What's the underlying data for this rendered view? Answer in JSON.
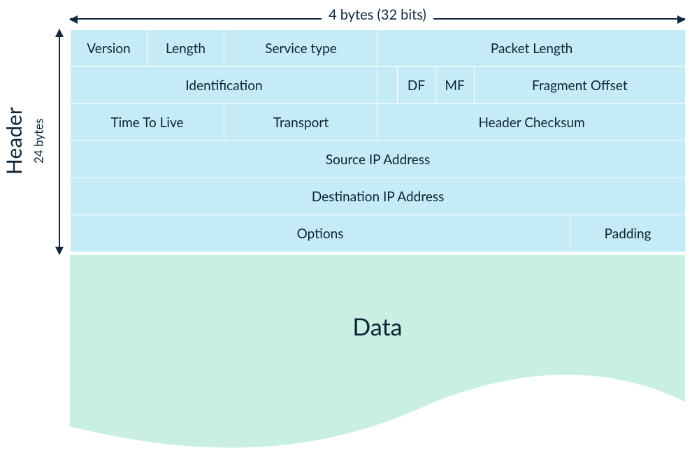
{
  "dimensions": {
    "width_label": "4 bytes (32 bits)",
    "height_label": "24 bytes",
    "section_label": "Header"
  },
  "header_rows": [
    [
      {
        "span": 4,
        "label": "Version"
      },
      {
        "span": 4,
        "label": "Length"
      },
      {
        "span": 8,
        "label": "Service type"
      },
      {
        "span": 16,
        "label": "Packet Length"
      }
    ],
    [
      {
        "span": 16,
        "label": "Identification"
      },
      {
        "span": 1,
        "label": ""
      },
      {
        "span": 2,
        "label": "DF"
      },
      {
        "span": 2,
        "label": "MF"
      },
      {
        "span": 11,
        "label": "Fragment Offset"
      }
    ],
    [
      {
        "span": 8,
        "label": "Time To Live"
      },
      {
        "span": 8,
        "label": "Transport"
      },
      {
        "span": 16,
        "label": "Header Checksum"
      }
    ],
    [
      {
        "span": 32,
        "label": "Source IP Address"
      }
    ],
    [
      {
        "span": 32,
        "label": "Destination IP Address"
      }
    ],
    [
      {
        "span": 26,
        "label": "Options"
      },
      {
        "span": 6,
        "label": "Padding"
      }
    ]
  ],
  "payload": {
    "label": "Data"
  },
  "colors": {
    "header_cell": "#c5ebf6",
    "data_fill": "#c9efe3",
    "text": "#0d2436",
    "arrow": "#12283f"
  }
}
